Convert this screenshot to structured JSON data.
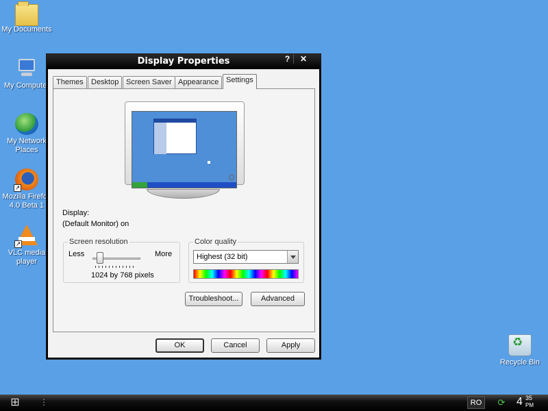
{
  "desktop": {
    "icons": [
      {
        "label": "My Documents",
        "icon": "folder-icon"
      },
      {
        "label": "My Computer",
        "icon": "computer-icon"
      },
      {
        "label": "My Network Places",
        "icon": "network-icon"
      },
      {
        "label": "Mozilla Firefox 4.0 Beta 1",
        "icon": "firefox-icon"
      },
      {
        "label": "VLC media player",
        "icon": "vlc-icon"
      },
      {
        "label": "Recycle Bin",
        "icon": "recycle-bin-icon"
      }
    ],
    "background_color": "#5aa0e6"
  },
  "window": {
    "title": "Display Properties",
    "help_label": "?",
    "close_label": "✕",
    "tabs": [
      {
        "label": "Themes"
      },
      {
        "label": "Desktop"
      },
      {
        "label": "Screen Saver"
      },
      {
        "label": "Appearance"
      },
      {
        "label": "Settings",
        "active": true
      }
    ],
    "display_label": "Display:",
    "display_value": "(Default Monitor) on",
    "resolution": {
      "legend": "Screen resolution",
      "less": "Less",
      "more": "More",
      "value": "1024 by 768 pixels"
    },
    "color_quality": {
      "legend": "Color quality",
      "selected": "Highest (32 bit)"
    },
    "buttons": {
      "troubleshoot": "Troubleshoot...",
      "advanced": "Advanced",
      "ok": "OK",
      "cancel": "Cancel",
      "apply": "Apply"
    }
  },
  "taskbar": {
    "language": "RO",
    "clock_hour": "4",
    "clock_minute": "35",
    "clock_ampm": "PM"
  }
}
